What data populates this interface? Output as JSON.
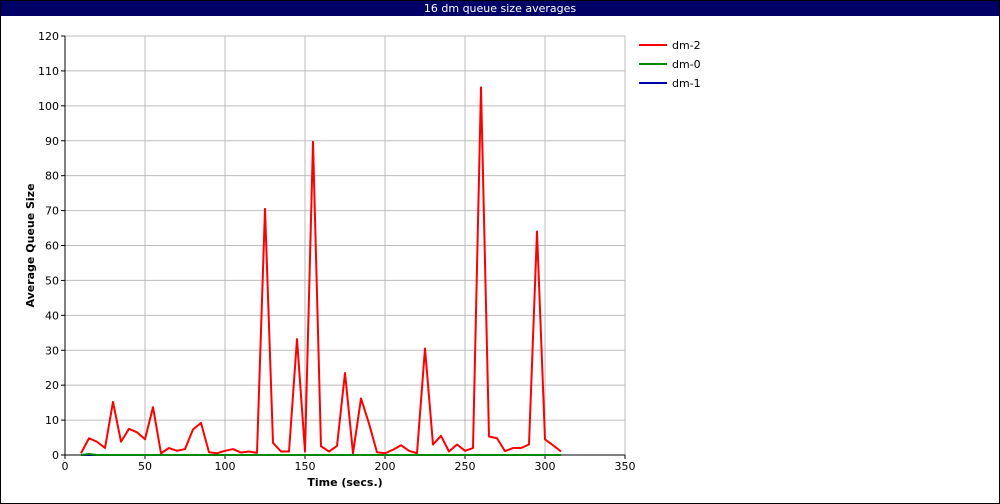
{
  "window": {
    "title": "16 dm queue size averages"
  },
  "chart_data": {
    "type": "line",
    "title": "16 dm queue size averages",
    "xlabel": "Time (secs.)",
    "ylabel": "Average Queue Size",
    "xlim": [
      0,
      350
    ],
    "ylim": [
      0,
      120
    ],
    "xticks": [
      0,
      50,
      100,
      150,
      200,
      250,
      300,
      350
    ],
    "yticks": [
      0,
      10,
      20,
      30,
      40,
      50,
      60,
      70,
      80,
      90,
      100,
      110,
      120
    ],
    "grid": true,
    "legend_position": "top-right",
    "series": [
      {
        "name": "dm-2",
        "color": "#ff0000",
        "x": [
          10,
          15,
          20,
          25,
          30,
          35,
          40,
          45,
          50,
          55,
          60,
          65,
          70,
          75,
          80,
          85,
          90,
          95,
          100,
          105,
          110,
          115,
          120,
          125,
          130,
          135,
          140,
          145,
          150,
          155,
          160,
          165,
          170,
          175,
          180,
          185,
          190,
          195,
          200,
          205,
          210,
          215,
          220,
          225,
          230,
          235,
          240,
          245,
          250,
          255,
          260,
          265,
          270,
          275,
          280,
          285,
          290,
          295,
          300,
          305,
          310
        ],
        "y": [
          0.5,
          4.8,
          3.8,
          2,
          15.2,
          3.8,
          7.5,
          6.5,
          4.5,
          13.7,
          0.5,
          2,
          1.2,
          1.7,
          7.3,
          9.2,
          0.8,
          0.5,
          1.2,
          1.7,
          0.7,
          1,
          0.6,
          70.5,
          3.5,
          1,
          1,
          33.2,
          1,
          89.7,
          2.5,
          1,
          2.6,
          23.5,
          0.5,
          16.2,
          9,
          0.8,
          0.5,
          1.5,
          2.8,
          1.2,
          0.5,
          30.5,
          3,
          5.5,
          1,
          3,
          1.2,
          2,
          105.3,
          5.3,
          4.8,
          1.1,
          2,
          2,
          3,
          64,
          4.5,
          2.8,
          1
        ]
      },
      {
        "name": "dm-0",
        "color": "#008800",
        "x": [
          10,
          15,
          20,
          25,
          30,
          35,
          40,
          45,
          50,
          55,
          60,
          65,
          70,
          75,
          80,
          85,
          90,
          95,
          100,
          105,
          110,
          115,
          120,
          125,
          130,
          135,
          140,
          145,
          150,
          155,
          160,
          165,
          170,
          175,
          180,
          185,
          190,
          195,
          200,
          205,
          210,
          215,
          220,
          225,
          230,
          235,
          240,
          245,
          250,
          255,
          260,
          265,
          270,
          275,
          280,
          285,
          290,
          295,
          300,
          305,
          310
        ],
        "y": [
          0,
          0.3,
          0,
          0,
          0,
          0,
          0,
          0,
          0,
          0,
          0,
          0,
          0,
          0,
          0,
          0,
          0,
          0,
          0,
          0,
          0,
          0,
          0,
          0,
          0,
          0,
          0,
          0,
          0,
          0,
          0,
          0,
          0,
          0,
          0,
          0,
          0,
          0,
          0,
          0,
          0,
          0,
          0,
          0,
          0,
          0,
          0,
          0,
          0,
          0,
          0,
          0,
          0,
          0,
          0,
          0,
          0,
          0,
          0,
          0,
          0
        ]
      },
      {
        "name": "dm-1",
        "color": "#0000aa",
        "x": [
          10,
          15,
          20,
          25,
          30,
          35,
          40,
          45,
          50,
          55,
          60,
          65,
          70,
          75,
          80,
          85,
          90,
          95,
          100,
          105,
          110,
          115,
          120,
          125,
          130,
          135,
          140,
          145,
          150,
          155,
          160,
          165,
          170,
          175,
          180,
          185,
          190,
          195,
          200,
          205,
          210,
          215,
          220,
          225,
          230,
          235,
          240,
          245,
          250,
          255,
          260,
          265,
          270,
          275,
          280,
          285,
          290,
          295,
          300,
          305,
          310
        ],
        "y": [
          0,
          0,
          0,
          0,
          0,
          0,
          0,
          0,
          0,
          0,
          0,
          0,
          0,
          0,
          0,
          0,
          0,
          0,
          0,
          0,
          0,
          0,
          0,
          0,
          0,
          0,
          0,
          0,
          0,
          0,
          0,
          0,
          0,
          0,
          0,
          0,
          0,
          0,
          0,
          0,
          0,
          0,
          0,
          0,
          0,
          0,
          0,
          0,
          0,
          0,
          0,
          0,
          0,
          0,
          0,
          0,
          0,
          0,
          0,
          0,
          0
        ]
      }
    ]
  }
}
